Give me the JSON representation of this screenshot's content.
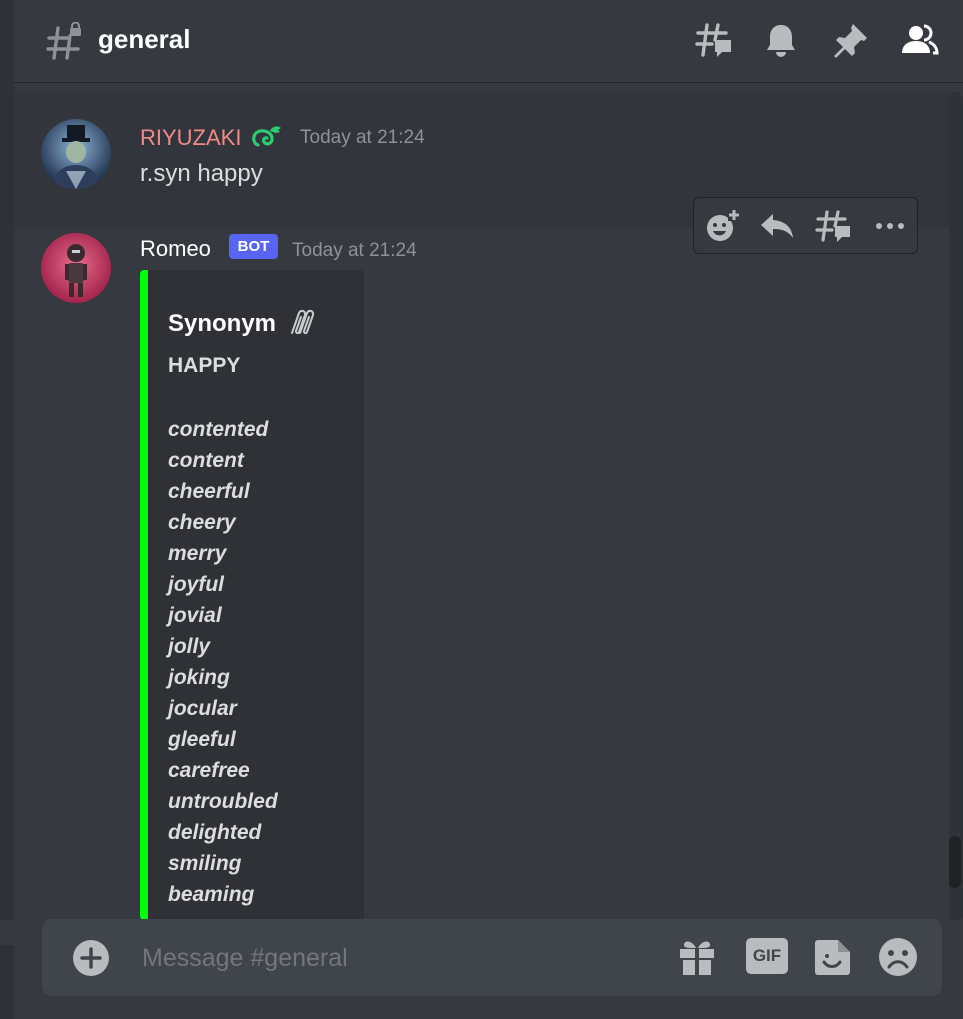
{
  "channel": {
    "name": "general"
  },
  "header_icons": [
    "threads-icon",
    "bell-icon",
    "pin-icon",
    "members-icon"
  ],
  "messages": [
    {
      "username": "RIYUZAKI",
      "username_color": "#f28a8a",
      "badge_icon": "serpent-badge-icon",
      "timestamp": "Today at 21:24",
      "text": "r.syn happy"
    },
    {
      "username": "Romeo",
      "username_color": "#ffffff",
      "tag": "BOT",
      "timestamp": "Today at 21:24",
      "embed": {
        "color": "#00ff0a",
        "title": "Synonym",
        "title_icon": "paperclips-icon",
        "word": "HAPPY",
        "synonyms": [
          "contented",
          "content",
          "cheerful",
          "cheery",
          "merry",
          "joyful",
          "jovial",
          "jolly",
          "joking",
          "jocular",
          "gleeful",
          "carefree",
          "untroubled",
          "delighted",
          "smiling",
          "beaming"
        ]
      }
    }
  ],
  "message_toolbar": [
    "add-reaction-icon",
    "reply-icon",
    "create-thread-icon",
    "more-icon"
  ],
  "composer": {
    "placeholder": "Message #general",
    "gif_label": "GIF"
  },
  "colors": {
    "background": "#36393f",
    "accent": "#5865f2",
    "embed_bar": "#00ff0a"
  }
}
